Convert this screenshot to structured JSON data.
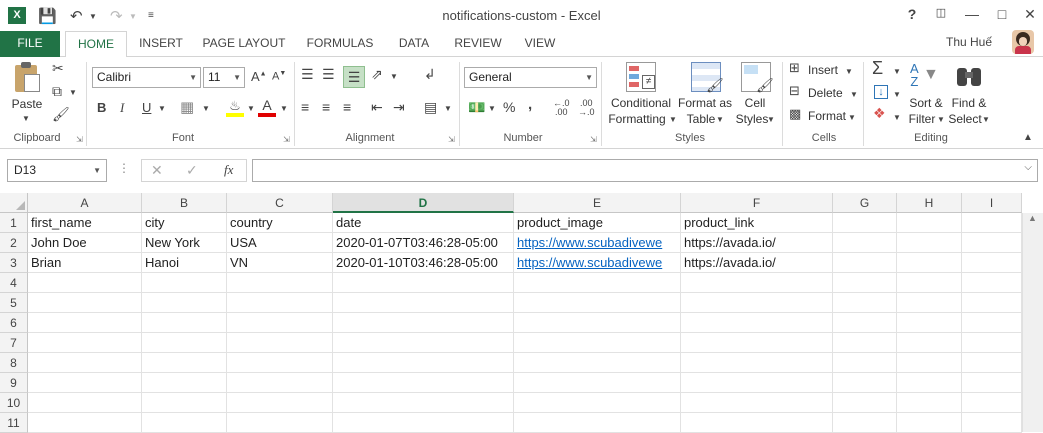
{
  "window": {
    "title": "notifications-custom - Excel",
    "help": "?",
    "user": "Thu Huế"
  },
  "tabs": [
    "FILE",
    "HOME",
    "INSERT",
    "PAGE LAYOUT",
    "FORMULAS",
    "DATA",
    "REVIEW",
    "VIEW"
  ],
  "ribbon": {
    "clipboard": {
      "paste": "Paste",
      "label": "Clipboard"
    },
    "font": {
      "name": "Calibri",
      "size": "11",
      "bold": "B",
      "italic": "I",
      "underline": "U",
      "label": "Font"
    },
    "alignment": {
      "label": "Alignment"
    },
    "number": {
      "format": "General",
      "percent": "%",
      "comma": ",",
      "label": "Number"
    },
    "styles": {
      "conditional_1": "Conditional",
      "conditional_2": "Formatting",
      "format_as_1": "Format as",
      "format_as_2": "Table",
      "cell_styles_1": "Cell",
      "cell_styles_2": "Styles",
      "label": "Styles"
    },
    "cells": {
      "insert": "Insert",
      "delete": "Delete",
      "format": "Format",
      "label": "Cells"
    },
    "editing": {
      "sort_1": "Sort &",
      "sort_2": "Filter",
      "find_1": "Find &",
      "find_2": "Select",
      "label": "Editing"
    }
  },
  "formula_bar": {
    "name_box": "D13",
    "fx": "fx",
    "value": ""
  },
  "grid": {
    "columns": [
      "A",
      "B",
      "C",
      "D",
      "E",
      "F",
      "G",
      "H",
      "I"
    ],
    "selected_column": "D",
    "row_numbers": [
      "1",
      "2",
      "3",
      "4",
      "5",
      "6",
      "7",
      "8",
      "9",
      "10",
      "11"
    ],
    "rows": [
      [
        "first_name",
        "city",
        "country",
        "date",
        "product_image",
        "product_link"
      ],
      [
        "John Doe",
        "New York",
        "USA",
        "2020-01-07T03:46:28-05:00",
        "https://www.scubadivewe",
        "https://avada.io/"
      ],
      [
        "Brian",
        "Hanoi",
        "VN",
        "2020-01-10T03:46:28-05:00",
        "https://www.scubadivewe",
        "https://avada.io/"
      ]
    ]
  },
  "colors": {
    "accent": "#217346",
    "link": "#0563c1"
  }
}
